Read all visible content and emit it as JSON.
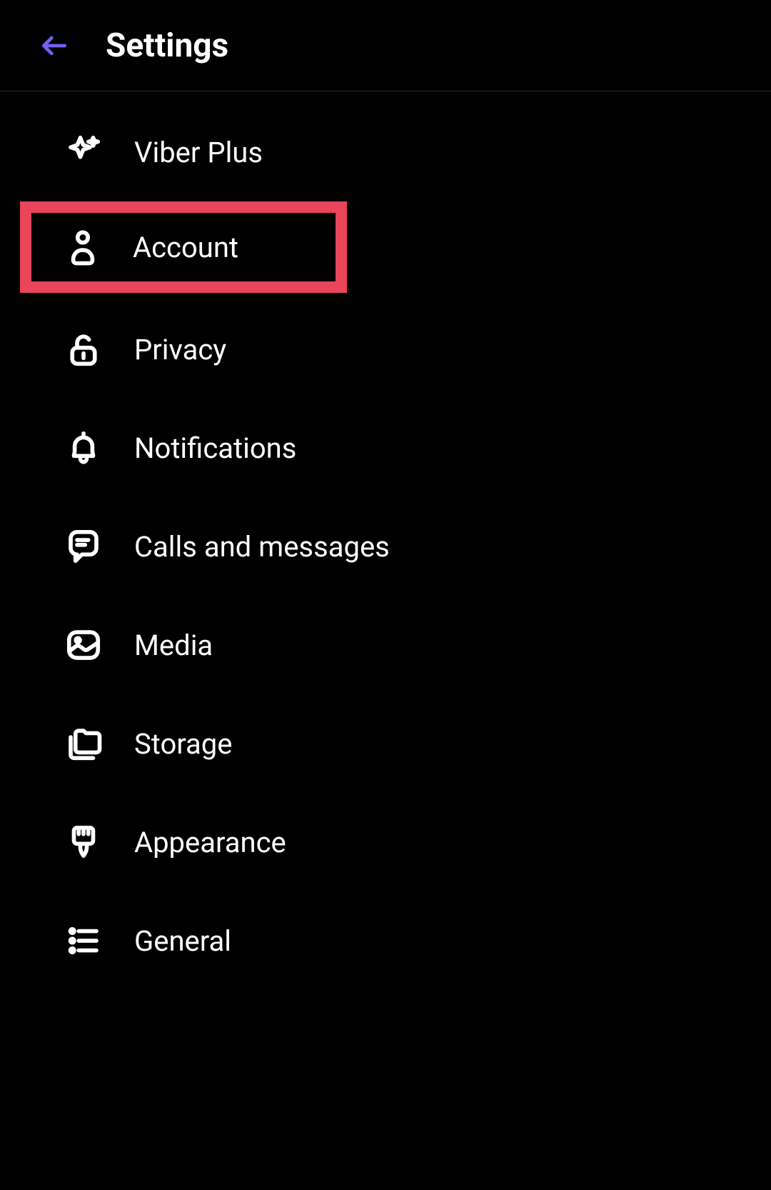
{
  "header": {
    "title": "Settings"
  },
  "items": [
    {
      "label": "Viber Plus",
      "icon": "sparkle",
      "highlighted": false
    },
    {
      "label": "Account",
      "icon": "account",
      "highlighted": true
    },
    {
      "label": "Privacy",
      "icon": "lock-open",
      "highlighted": false
    },
    {
      "label": "Notifications",
      "icon": "bell",
      "highlighted": false
    },
    {
      "label": "Calls and messages",
      "icon": "message",
      "highlighted": false
    },
    {
      "label": "Media",
      "icon": "media",
      "highlighted": false
    },
    {
      "label": "Storage",
      "icon": "folders",
      "highlighted": false
    },
    {
      "label": "Appearance",
      "icon": "brush",
      "highlighted": false
    },
    {
      "label": "General",
      "icon": "list",
      "highlighted": false
    }
  ],
  "colors": {
    "accent": "#7360f2",
    "highlight": "#e9455b",
    "bg": "#000000",
    "text": "#ffffff"
  }
}
